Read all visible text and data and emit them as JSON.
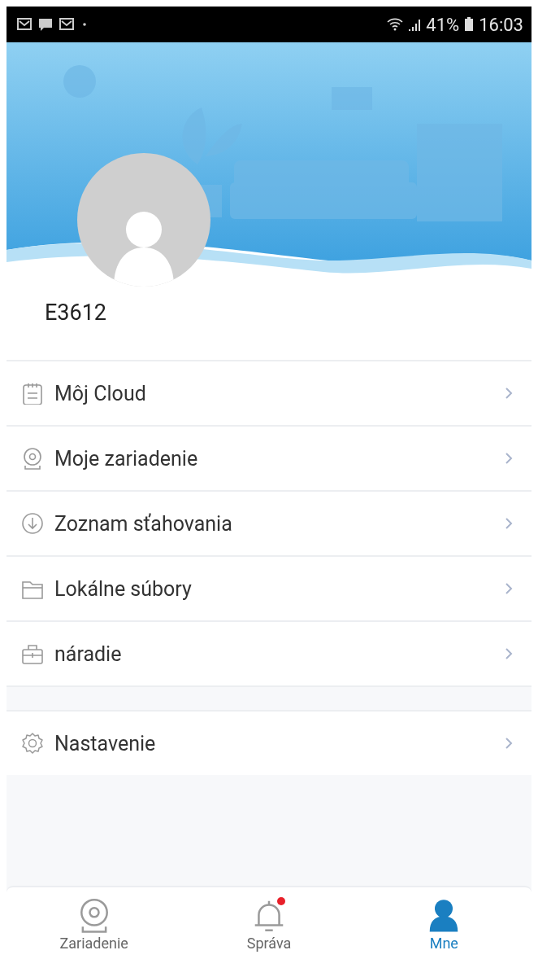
{
  "status_bar": {
    "battery": "41%",
    "time": "16:03"
  },
  "profile": {
    "username": "E3612"
  },
  "menu_groups": [
    {
      "items": [
        {
          "label": "Môj Cloud"
        },
        {
          "label": "Moje zariadenie"
        },
        {
          "label": "Zoznam sťahovania"
        },
        {
          "label": "Lokálne súbory"
        },
        {
          "label": "náradie"
        }
      ]
    },
    {
      "items": [
        {
          "label": "Nastavenie"
        }
      ]
    }
  ],
  "tabs": [
    {
      "label": "Zariadenie",
      "selected": false,
      "badge": false
    },
    {
      "label": "Správa",
      "selected": false,
      "badge": true
    },
    {
      "label": "Mne",
      "selected": true,
      "badge": false
    }
  ]
}
